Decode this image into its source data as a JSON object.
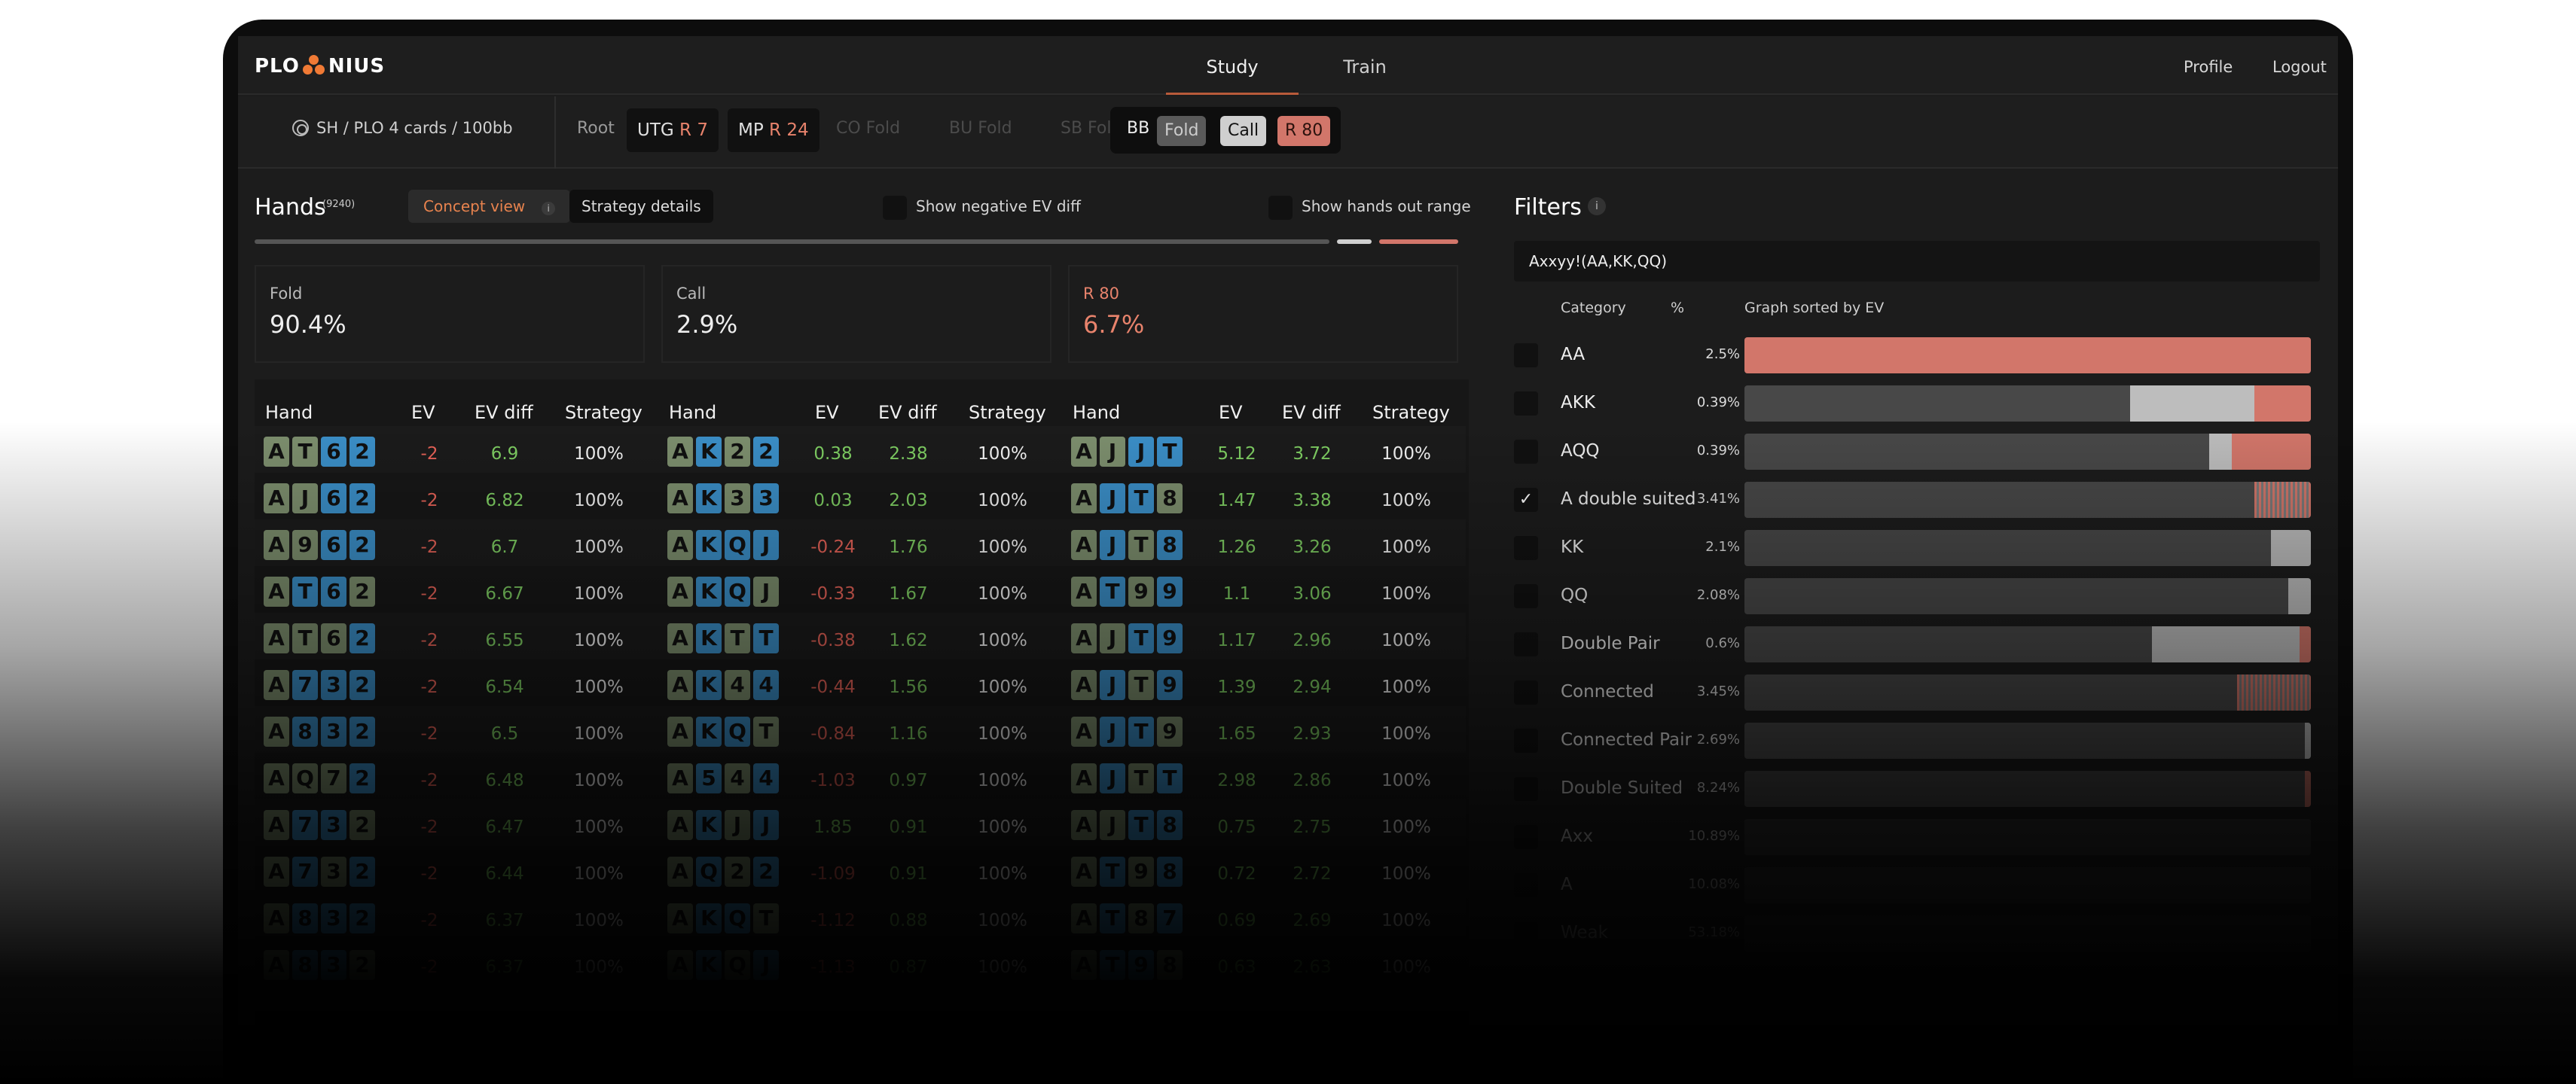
{
  "app": {
    "logo_left": "PLO",
    "logo_right": "NIUS",
    "brand_color": "#f07a35"
  },
  "nav": {
    "tabs": [
      {
        "label": "Study"
      },
      {
        "label": "Train"
      }
    ],
    "profile": "Profile",
    "logout": "Logout"
  },
  "actionbar": {
    "game": "SH / PLO 4 cards / 100bb",
    "root": "Root",
    "utg": {
      "pos": "UTG",
      "action": "R 7"
    },
    "mp": {
      "pos": "MP",
      "action": "R 24"
    },
    "co": "CO Fold",
    "bu": "BU Fold",
    "sb": "SB Fold",
    "bb": {
      "pos": "BB",
      "fold": "Fold",
      "call": "Call",
      "raise": "R 80"
    }
  },
  "hands": {
    "title": "Hands",
    "count": "(9240)",
    "concept_view": "Concept view",
    "concept_info": "i",
    "strategy_details": "Strategy details",
    "show_negative": "Show negative EV diff",
    "show_out_range": "Show hands out range",
    "progress": {
      "fold": 90.4,
      "call": 2.9,
      "raise": 6.7
    }
  },
  "stats": [
    {
      "label": "Fold",
      "value": "90.4%"
    },
    {
      "label": "Call",
      "value": "2.9%"
    },
    {
      "label": "R 80",
      "value": "6.7%"
    }
  ],
  "table": {
    "headers": {
      "hand": "Hand",
      "ev": "EV",
      "evdiff": "EV diff",
      "strategy": "Strategy"
    },
    "columns": [
      [
        {
          "cards": [
            "A",
            "T",
            "6",
            "2"
          ],
          "suits": [
            "g",
            "g",
            "b",
            "b"
          ],
          "ev": "-2",
          "evdiff": "6.9",
          "strategy": "100%"
        },
        {
          "cards": [
            "A",
            "J",
            "6",
            "2"
          ],
          "suits": [
            "g",
            "g",
            "b",
            "b"
          ],
          "ev": "-2",
          "evdiff": "6.82",
          "strategy": "100%"
        },
        {
          "cards": [
            "A",
            "9",
            "6",
            "2"
          ],
          "suits": [
            "g",
            "g",
            "b",
            "b"
          ],
          "ev": "-2",
          "evdiff": "6.7",
          "strategy": "100%"
        },
        {
          "cards": [
            "A",
            "T",
            "6",
            "2"
          ],
          "suits": [
            "g",
            "b",
            "b",
            "g"
          ],
          "ev": "-2",
          "evdiff": "6.67",
          "strategy": "100%"
        },
        {
          "cards": [
            "A",
            "T",
            "6",
            "2"
          ],
          "suits": [
            "g",
            "g",
            "g",
            "b"
          ],
          "ev": "-2",
          "evdiff": "6.55",
          "strategy": "100%"
        },
        {
          "cards": [
            "A",
            "7",
            "3",
            "2"
          ],
          "suits": [
            "g",
            "b",
            "b",
            "b"
          ],
          "ev": "-2",
          "evdiff": "6.54",
          "strategy": "100%"
        },
        {
          "cards": [
            "A",
            "8",
            "3",
            "2"
          ],
          "suits": [
            "g",
            "b",
            "b",
            "b"
          ],
          "ev": "-2",
          "evdiff": "6.5",
          "strategy": "100%"
        },
        {
          "cards": [
            "A",
            "Q",
            "7",
            "2"
          ],
          "suits": [
            "g",
            "g",
            "g",
            "b"
          ],
          "ev": "-2",
          "evdiff": "6.48",
          "strategy": "100%"
        },
        {
          "cards": [
            "A",
            "7",
            "3",
            "2"
          ],
          "suits": [
            "g",
            "b",
            "b",
            "g"
          ],
          "ev": "-2",
          "evdiff": "6.47",
          "strategy": "100%"
        },
        {
          "cards": [
            "A",
            "7",
            "3",
            "2"
          ],
          "suits": [
            "g",
            "b",
            "g",
            "b"
          ],
          "ev": "-2",
          "evdiff": "6.44",
          "strategy": "100%"
        },
        {
          "cards": [
            "A",
            "8",
            "3",
            "2"
          ],
          "suits": [
            "g",
            "b",
            "b",
            "b"
          ],
          "ev": "-2",
          "evdiff": "6.37",
          "strategy": "100%"
        },
        {
          "cards": [
            "A",
            "8",
            "3",
            "2"
          ],
          "suits": [
            "g",
            "b",
            "b",
            "g"
          ],
          "ev": "-2",
          "evdiff": "6.37",
          "strategy": "100%"
        }
      ],
      [
        {
          "cards": [
            "A",
            "K",
            "2",
            "2"
          ],
          "suits": [
            "g",
            "b",
            "g",
            "b"
          ],
          "ev": "0.38",
          "evdiff": "2.38",
          "strategy": "100%"
        },
        {
          "cards": [
            "A",
            "K",
            "3",
            "3"
          ],
          "suits": [
            "g",
            "b",
            "g",
            "b"
          ],
          "ev": "0.03",
          "evdiff": "2.03",
          "strategy": "100%"
        },
        {
          "cards": [
            "A",
            "K",
            "Q",
            "J"
          ],
          "suits": [
            "g",
            "b",
            "b",
            "b"
          ],
          "ev": "-0.24",
          "evdiff": "1.76",
          "strategy": "100%"
        },
        {
          "cards": [
            "A",
            "K",
            "Q",
            "J"
          ],
          "suits": [
            "g",
            "b",
            "b",
            "g"
          ],
          "ev": "-0.33",
          "evdiff": "1.67",
          "strategy": "100%"
        },
        {
          "cards": [
            "A",
            "K",
            "T",
            "T"
          ],
          "suits": [
            "g",
            "b",
            "g",
            "b"
          ],
          "ev": "-0.38",
          "evdiff": "1.62",
          "strategy": "100%"
        },
        {
          "cards": [
            "A",
            "K",
            "4",
            "4"
          ],
          "suits": [
            "g",
            "b",
            "g",
            "b"
          ],
          "ev": "-0.44",
          "evdiff": "1.56",
          "strategy": "100%"
        },
        {
          "cards": [
            "A",
            "K",
            "Q",
            "T"
          ],
          "suits": [
            "g",
            "b",
            "b",
            "g"
          ],
          "ev": "-0.84",
          "evdiff": "1.16",
          "strategy": "100%"
        },
        {
          "cards": [
            "A",
            "5",
            "4",
            "4"
          ],
          "suits": [
            "g",
            "b",
            "g",
            "b"
          ],
          "ev": "-1.03",
          "evdiff": "0.97",
          "strategy": "100%"
        },
        {
          "cards": [
            "A",
            "K",
            "J",
            "J"
          ],
          "suits": [
            "g",
            "b",
            "g",
            "b"
          ],
          "ev": "1.85",
          "evdiff": "0.91",
          "strategy": "100%"
        },
        {
          "cards": [
            "A",
            "Q",
            "2",
            "2"
          ],
          "suits": [
            "g",
            "b",
            "g",
            "b"
          ],
          "ev": "-1.09",
          "evdiff": "0.91",
          "strategy": "100%"
        },
        {
          "cards": [
            "A",
            "K",
            "Q",
            "T"
          ],
          "suits": [
            "g",
            "b",
            "b",
            "g"
          ],
          "ev": "-1.12",
          "evdiff": "0.88",
          "strategy": "100%"
        },
        {
          "cards": [
            "A",
            "K",
            "Q",
            "J"
          ],
          "suits": [
            "g",
            "b",
            "g",
            "b"
          ],
          "ev": "-1.13",
          "evdiff": "0.87",
          "strategy": "100%"
        }
      ],
      [
        {
          "cards": [
            "A",
            "J",
            "J",
            "T"
          ],
          "suits": [
            "g",
            "g",
            "b",
            "b"
          ],
          "ev": "5.12",
          "evdiff": "3.72",
          "strategy": "100%"
        },
        {
          "cards": [
            "A",
            "J",
            "T",
            "8"
          ],
          "suits": [
            "g",
            "b",
            "b",
            "g"
          ],
          "ev": "1.47",
          "evdiff": "3.38",
          "strategy": "100%"
        },
        {
          "cards": [
            "A",
            "J",
            "T",
            "8"
          ],
          "suits": [
            "g",
            "b",
            "g",
            "b"
          ],
          "ev": "1.26",
          "evdiff": "3.26",
          "strategy": "100%"
        },
        {
          "cards": [
            "A",
            "T",
            "9",
            "9"
          ],
          "suits": [
            "g",
            "b",
            "g",
            "b"
          ],
          "ev": "1.1",
          "evdiff": "3.06",
          "strategy": "100%"
        },
        {
          "cards": [
            "A",
            "J",
            "T",
            "9"
          ],
          "suits": [
            "g",
            "g",
            "b",
            "b"
          ],
          "ev": "1.17",
          "evdiff": "2.96",
          "strategy": "100%"
        },
        {
          "cards": [
            "A",
            "J",
            "T",
            "9"
          ],
          "suits": [
            "g",
            "b",
            "g",
            "b"
          ],
          "ev": "1.39",
          "evdiff": "2.94",
          "strategy": "100%"
        },
        {
          "cards": [
            "A",
            "J",
            "T",
            "9"
          ],
          "suits": [
            "g",
            "b",
            "b",
            "g"
          ],
          "ev": "1.65",
          "evdiff": "2.93",
          "strategy": "100%"
        },
        {
          "cards": [
            "A",
            "J",
            "T",
            "T"
          ],
          "suits": [
            "g",
            "b",
            "g",
            "b"
          ],
          "ev": "2.98",
          "evdiff": "2.86",
          "strategy": "100%"
        },
        {
          "cards": [
            "A",
            "J",
            "T",
            "8"
          ],
          "suits": [
            "g",
            "g",
            "b",
            "b"
          ],
          "ev": "0.75",
          "evdiff": "2.75",
          "strategy": "100%"
        },
        {
          "cards": [
            "A",
            "T",
            "9",
            "8"
          ],
          "suits": [
            "g",
            "b",
            "g",
            "b"
          ],
          "ev": "0.72",
          "evdiff": "2.72",
          "strategy": "100%"
        },
        {
          "cards": [
            "A",
            "T",
            "8",
            "7"
          ],
          "suits": [
            "g",
            "b",
            "g",
            "b"
          ],
          "ev": "0.69",
          "evdiff": "2.69",
          "strategy": "100%"
        },
        {
          "cards": [
            "A",
            "T",
            "9",
            "8"
          ],
          "suits": [
            "g",
            "b",
            "b",
            "g"
          ],
          "ev": "0.63",
          "evdiff": "2.63",
          "strategy": "100%"
        }
      ]
    ]
  },
  "filters": {
    "title": "Filters",
    "info": "i",
    "input": "Axxyy!(AA,KK,QQ)",
    "headers": {
      "category": "Category",
      "pct": "%",
      "graph": "Graph sorted by EV"
    },
    "rows": [
      {
        "name": "AA",
        "pct": "2.5%",
        "checked": false,
        "call": 0,
        "raise": 1.0,
        "hatch": 0,
        "dark": 0
      },
      {
        "name": "AKK",
        "pct": "0.39%",
        "checked": false,
        "call": 0.22,
        "raise": 0.1,
        "hatch": 0,
        "dark": 0
      },
      {
        "name": "AQQ",
        "pct": "0.39%",
        "checked": false,
        "call": 0.04,
        "raise": 0.14,
        "hatch": 0,
        "dark": 0
      },
      {
        "name": "A double suited",
        "pct": "3.41%",
        "checked": true,
        "call": 0,
        "raise": 0,
        "hatch": 0.1,
        "dark": 0
      },
      {
        "name": "KK",
        "pct": "2.1%",
        "checked": false,
        "call": 0.07,
        "raise": 0,
        "hatch": 0,
        "dark": 0
      },
      {
        "name": "QQ",
        "pct": "2.08%",
        "checked": false,
        "call": 0.04,
        "raise": 0,
        "hatch": 0,
        "dark": 0
      },
      {
        "name": "Double Pair",
        "pct": "0.6%",
        "checked": false,
        "call": 0.26,
        "raise": 0.02,
        "hatch": 0,
        "dark": 0
      },
      {
        "name": "Connected",
        "pct": "3.45%",
        "checked": false,
        "call": 0,
        "raise": 0,
        "hatch": 0.13,
        "dark": 0
      },
      {
        "name": "Connected Pair",
        "pct": "2.69%",
        "checked": false,
        "call": 0.01,
        "raise": 0,
        "hatch": 0,
        "dark": 0
      },
      {
        "name": "Double Suited",
        "pct": "8.24%",
        "checked": false,
        "call": 0,
        "raise": 0.01,
        "hatch": 0,
        "dark": 0
      },
      {
        "name": "Axx",
        "pct": "10.89%",
        "checked": false,
        "call": 0,
        "raise": 0,
        "hatch": 0,
        "dark": 1
      },
      {
        "name": "A",
        "pct": "10.08%",
        "checked": false,
        "call": 0,
        "raise": 0,
        "hatch": 0,
        "dark": 1
      },
      {
        "name": "Weak",
        "pct": "53.18%",
        "checked": false,
        "call": 0,
        "raise": 0,
        "hatch": 0,
        "dark": 1
      }
    ]
  },
  "colors": {
    "fold": "#555555",
    "call": "#cfcfcf",
    "raise": "#d2766a",
    "suit_green": "#7d8f6e",
    "suit_blue": "#3b8fc8",
    "positive": "#7fcf63",
    "negative": "#e86358"
  }
}
